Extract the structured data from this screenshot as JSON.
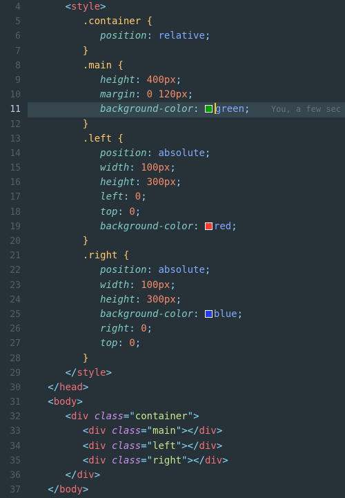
{
  "editor": {
    "active_line": 11,
    "codelens_text": "You, a few sec",
    "lines": {
      "4": {
        "indent": 2,
        "kind": "open_tag",
        "tag": "style"
      },
      "5": {
        "indent": 3,
        "kind": "rule_open",
        "selector": ".container"
      },
      "6": {
        "indent": 4,
        "kind": "decl",
        "prop": "position",
        "value": "relative"
      },
      "7": {
        "indent": 3,
        "kind": "rule_close"
      },
      "8": {
        "indent": 3,
        "kind": "rule_open",
        "selector": ".main"
      },
      "9": {
        "indent": 4,
        "kind": "decl",
        "prop": "height",
        "value": "400",
        "unit": "px"
      },
      "10": {
        "indent": 4,
        "kind": "decl_margin",
        "prop": "margin",
        "v1": "0",
        "v2": "120",
        "unit": "px"
      },
      "11": {
        "indent": 4,
        "kind": "decl_color",
        "prop": "background-color",
        "value": "green",
        "swatch": "#00a000",
        "cursor": true
      },
      "12": {
        "indent": 3,
        "kind": "rule_close"
      },
      "13": {
        "indent": 3,
        "kind": "rule_open",
        "selector": ".left"
      },
      "14": {
        "indent": 4,
        "kind": "decl",
        "prop": "position",
        "value": "absolute"
      },
      "15": {
        "indent": 4,
        "kind": "decl",
        "prop": "width",
        "value": "100",
        "unit": "px"
      },
      "16": {
        "indent": 4,
        "kind": "decl",
        "prop": "height",
        "value": "300",
        "unit": "px"
      },
      "17": {
        "indent": 4,
        "kind": "decl",
        "prop": "left",
        "value": "0"
      },
      "18": {
        "indent": 4,
        "kind": "decl",
        "prop": "top",
        "value": "0"
      },
      "19": {
        "indent": 4,
        "kind": "decl_color",
        "prop": "background-color",
        "value": "red",
        "swatch": "#ff3b30"
      },
      "20": {
        "indent": 3,
        "kind": "rule_close"
      },
      "21": {
        "indent": 3,
        "kind": "rule_open",
        "selector": ".right"
      },
      "22": {
        "indent": 4,
        "kind": "decl",
        "prop": "position",
        "value": "absolute"
      },
      "23": {
        "indent": 4,
        "kind": "decl",
        "prop": "width",
        "value": "100",
        "unit": "px"
      },
      "24": {
        "indent": 4,
        "kind": "decl",
        "prop": "height",
        "value": "300",
        "unit": "px"
      },
      "25": {
        "indent": 4,
        "kind": "decl_color",
        "prop": "background-color",
        "value": "blue",
        "swatch": "#1e3cff"
      },
      "26": {
        "indent": 4,
        "kind": "decl",
        "prop": "right",
        "value": "0"
      },
      "27": {
        "indent": 4,
        "kind": "decl",
        "prop": "top",
        "value": "0"
      },
      "28": {
        "indent": 3,
        "kind": "rule_close"
      },
      "29": {
        "indent": 2,
        "kind": "close_tag",
        "tag": "style"
      },
      "30": {
        "indent": 1,
        "kind": "close_tag",
        "tag": "head"
      },
      "31": {
        "indent": 1,
        "kind": "open_tag",
        "tag": "body"
      },
      "32": {
        "indent": 2,
        "kind": "div_open",
        "class": "container"
      },
      "33": {
        "indent": 3,
        "kind": "div_empty",
        "class": "main"
      },
      "34": {
        "indent": 3,
        "kind": "div_empty",
        "class": "left"
      },
      "35": {
        "indent": 3,
        "kind": "div_empty",
        "class": "right"
      },
      "36": {
        "indent": 2,
        "kind": "close_tag",
        "tag": "div"
      },
      "37": {
        "indent": 1,
        "kind": "close_tag",
        "tag": "body"
      }
    }
  }
}
